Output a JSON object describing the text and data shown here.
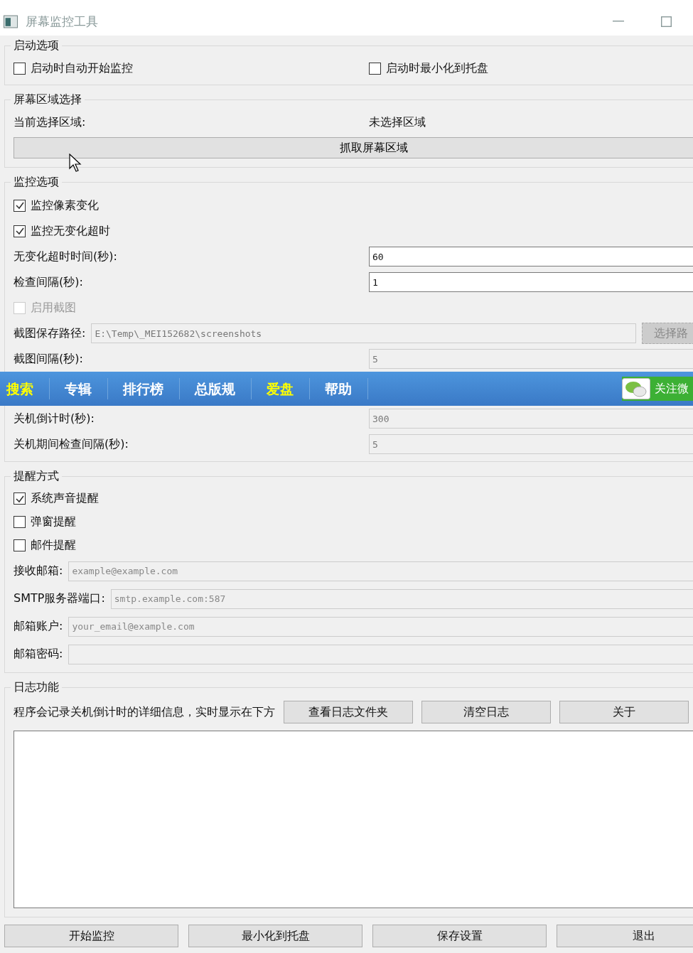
{
  "window": {
    "title": "屏幕监控工具"
  },
  "startup": {
    "title": "启动选项",
    "options": [
      {
        "label": "启动时自动开始监控",
        "checked": false
      },
      {
        "label": "启动时最小化到托盘",
        "checked": false
      }
    ]
  },
  "region": {
    "title": "屏幕区域选择",
    "label": "当前选择区域:",
    "value": "未选择区域",
    "button": "抓取屏幕区域"
  },
  "monitor": {
    "title": "监控选项",
    "rows": [
      {
        "kind": "checkbox",
        "label": "监控像素变化",
        "checked": true,
        "disabled": false
      },
      {
        "kind": "checkbox",
        "label": "监控无变化超时",
        "checked": true,
        "disabled": false
      },
      {
        "kind": "field",
        "label": "无变化超时时间(秒):",
        "value": "60",
        "disabled": false
      },
      {
        "kind": "field",
        "label": "检查间隔(秒):",
        "value": "1",
        "disabled": false
      },
      {
        "kind": "checkbox",
        "label": "启用截图",
        "checked": false,
        "disabled": true
      },
      {
        "kind": "path",
        "label": "截图保存路径:",
        "value": "E:\\Temp\\_MEI152682\\screenshots",
        "disabled": true,
        "button": "选择路"
      },
      {
        "kind": "field",
        "label": "截图间隔(秒):",
        "value": "5",
        "disabled": true
      }
    ]
  },
  "forum_nav": {
    "items": [
      {
        "label": "搜索",
        "color": "#ffff00"
      },
      {
        "label": "专辑",
        "color": "#ffffff"
      },
      {
        "label": "排行榜",
        "color": "#ffffff"
      },
      {
        "label": "总版规",
        "color": "#ffffff"
      },
      {
        "label": "爱盘",
        "color": "#ffff00"
      },
      {
        "label": "帮助",
        "color": "#ffffff"
      }
    ],
    "follow": "关注微"
  },
  "monitor_continued": {
    "rows": [
      {
        "label": "关机倒计时(秒):",
        "value": "300",
        "disabled": true
      },
      {
        "label": "关机期间检查间隔(秒):",
        "value": "5",
        "disabled": true
      }
    ]
  },
  "alerts": {
    "title": "提醒方式",
    "checks": [
      {
        "label": "系统声音提醒",
        "checked": true
      },
      {
        "label": "弹窗提醒",
        "checked": false
      },
      {
        "label": "邮件提醒",
        "checked": false
      }
    ],
    "fields": [
      {
        "label": "接收邮箱:",
        "placeholder": "example@example.com"
      },
      {
        "label": "SMTP服务器端口:",
        "placeholder": "smtp.example.com:587"
      },
      {
        "label": "邮箱账户:",
        "placeholder": "your_email@example.com"
      },
      {
        "label": "邮箱密码:"
      }
    ]
  },
  "log": {
    "title": "日志功能",
    "description": "程序会记录关机倒计时的详细信息，实时显示在下方",
    "buttons": [
      "查看日志文件夹",
      "清空日志",
      "关于"
    ]
  },
  "footer_buttons": [
    "开始监控",
    "最小化到托盘",
    "保存设置",
    "退出"
  ]
}
